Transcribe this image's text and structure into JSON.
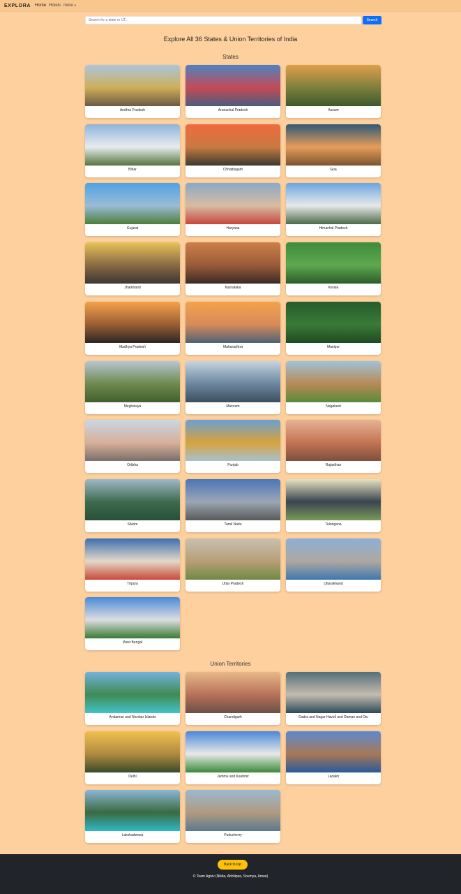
{
  "navbar": {
    "brand": "EXPLORA",
    "links": [
      "Home",
      "Hotels",
      "more"
    ]
  },
  "search": {
    "placeholder": "Search for a state or UT...",
    "button_label": "Search"
  },
  "page_title": "Explore All 36 States & Union Territories of India",
  "sections": {
    "states_title": "States",
    "ut_title": "Union Territories"
  },
  "states": [
    {
      "name": "Andhra Pradesh",
      "colors": [
        "#aac6df",
        "#cfae5a",
        "#6b5a45"
      ]
    },
    {
      "name": "Arunachal Pradesh",
      "colors": [
        "#4d83c2",
        "#c54a56",
        "#4b5d7e"
      ]
    },
    {
      "name": "Assam",
      "colors": [
        "#e0a04a",
        "#7d7f3d",
        "#3e5a2a"
      ]
    },
    {
      "name": "Bihar",
      "colors": [
        "#8fb3dc",
        "#e8ecef",
        "#54753d"
      ]
    },
    {
      "name": "Chhattisgarh",
      "colors": [
        "#f06a3e",
        "#c97a42",
        "#3a3a30"
      ]
    },
    {
      "name": "Goa",
      "colors": [
        "#2d5977",
        "#e79c59",
        "#7a5530"
      ]
    },
    {
      "name": "Gujarat",
      "colors": [
        "#4fa1e4",
        "#9bbcd7",
        "#4c7f3a"
      ]
    },
    {
      "name": "Haryana",
      "colors": [
        "#8aa9c8",
        "#d8bca1",
        "#c6473e"
      ]
    },
    {
      "name": "Himachal Pradesh",
      "colors": [
        "#6aa6e0",
        "#e8e8ea",
        "#4e6b4a"
      ]
    },
    {
      "name": "Jharkhand",
      "colors": [
        "#e8c25a",
        "#8a6b45",
        "#3d3632"
      ]
    },
    {
      "name": "Karnataka",
      "colors": [
        "#cd8048",
        "#9a5b3a",
        "#3b2a25"
      ]
    },
    {
      "name": "Kerala",
      "colors": [
        "#3f8b3b",
        "#5fa850",
        "#2b5c2a"
      ]
    },
    {
      "name": "Madhya Pradesh",
      "colors": [
        "#f4a24a",
        "#9b5e35",
        "#2b2523"
      ]
    },
    {
      "name": "Maharashtra",
      "colors": [
        "#f3a34c",
        "#d88a5a",
        "#4c6375"
      ]
    },
    {
      "name": "Manipur",
      "colors": [
        "#275c2c",
        "#3a7a38",
        "#1f4a22"
      ]
    },
    {
      "name": "Meghalaya",
      "colors": [
        "#b8c6d2",
        "#6e8a50",
        "#415f2d"
      ]
    },
    {
      "name": "Mizoram",
      "colors": [
        "#c5d4e0",
        "#6b87a0",
        "#3e4f5e"
      ]
    },
    {
      "name": "Nagaland",
      "colors": [
        "#9ec2d8",
        "#b88a56",
        "#5b8a3a"
      ]
    },
    {
      "name": "Odisha",
      "colors": [
        "#c8d8e6",
        "#d8b09a",
        "#7a6f6a"
      ]
    },
    {
      "name": "Punjab",
      "colors": [
        "#6aa0d4",
        "#d7a23a",
        "#a8c0d0"
      ]
    },
    {
      "name": "Rajasthan",
      "colors": [
        "#e6b294",
        "#c47454",
        "#7f4f3f"
      ]
    },
    {
      "name": "Sikkim",
      "colors": [
        "#a0b8c8",
        "#3e6b4e",
        "#27503a"
      ]
    },
    {
      "name": "Tamil Nadu",
      "colors": [
        "#4a76b8",
        "#9ca6b5",
        "#5a5a58"
      ]
    },
    {
      "name": "Telangana",
      "colors": [
        "#e8e2c0",
        "#3a4450",
        "#7a9a58"
      ]
    },
    {
      "name": "Tripura",
      "colors": [
        "#3b6fb0",
        "#e4d8c8",
        "#c84a3a"
      ]
    },
    {
      "name": "Uttar Pradesh",
      "colors": [
        "#c8c0b0",
        "#b89e78",
        "#6f8a44"
      ]
    },
    {
      "name": "Uttarakhand",
      "colors": [
        "#8ab0d8",
        "#b0a8a0",
        "#3e78b0"
      ]
    },
    {
      "name": "West Bengal",
      "colors": [
        "#4a8ad8",
        "#dcdde0",
        "#3a7a34"
      ]
    }
  ],
  "union_territories": [
    {
      "name": "Andaman and Nicobar Islands",
      "colors": [
        "#74b2de",
        "#3f8a54",
        "#45c2c8"
      ]
    },
    {
      "name": "Chandigarh",
      "colors": [
        "#e8b888",
        "#b8725a",
        "#6a5048"
      ]
    },
    {
      "name": "Dadra and Nagar Haveli and Daman and Diu",
      "colors": [
        "#566e78",
        "#c4bcb0",
        "#2e4a58"
      ]
    },
    {
      "name": "Delhi",
      "colors": [
        "#f0c050",
        "#b08a40",
        "#3a4a2a"
      ]
    },
    {
      "name": "Jammu and Kashmir",
      "colors": [
        "#4a88d8",
        "#e8e8e8",
        "#3a8a3a"
      ]
    },
    {
      "name": "Ladakh",
      "colors": [
        "#5a8ad0",
        "#a87858",
        "#2a5a9a"
      ]
    },
    {
      "name": "Lakshadweep",
      "colors": [
        "#8ab6d8",
        "#3a6a40",
        "#30b8c8"
      ]
    },
    {
      "name": "Puducherry",
      "colors": [
        "#9ab8d0",
        "#b09a80",
        "#5a7a90"
      ]
    }
  ],
  "footer": {
    "back_to_top": "Back to top",
    "credits": "© Team Agniv (Nikita, Abhilipsa, Soumya, Aman)"
  }
}
